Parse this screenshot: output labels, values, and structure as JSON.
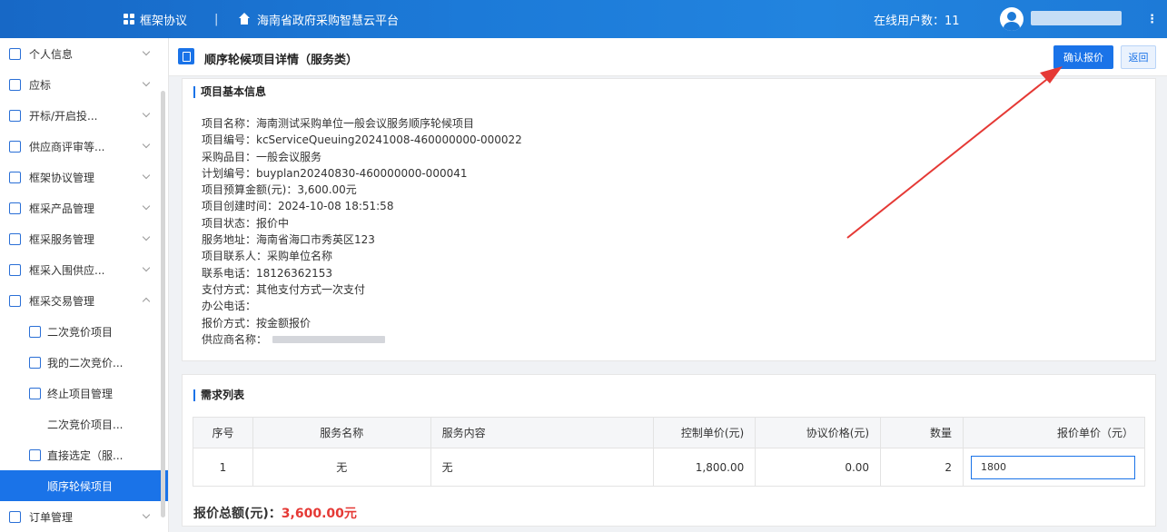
{
  "topbar": {
    "framework_label": "框架协议",
    "separator": "|",
    "platform_name": "海南省政府采购智慧云平台",
    "online_users": "在线用户数：11",
    "more_label": "⋮"
  },
  "sidebar": {
    "items": [
      {
        "label": "个人信息"
      },
      {
        "label": "应标"
      },
      {
        "label": "开标/开启投..."
      },
      {
        "label": "供应商评审等..."
      },
      {
        "label": "框架协议管理"
      },
      {
        "label": "框采产品管理"
      },
      {
        "label": "框采服务管理"
      },
      {
        "label": "框采入围供应..."
      },
      {
        "label": "框采交易管理"
      }
    ],
    "sub_items": [
      {
        "label": "二次竞价项目"
      },
      {
        "label": "我的二次竞价..."
      },
      {
        "label": "终止项目管理"
      },
      {
        "label": "二次竞价项目..."
      },
      {
        "label": "直接选定（服..."
      },
      {
        "label": "顺序轮候项目"
      }
    ],
    "last_item": {
      "label": "订单管理"
    }
  },
  "page": {
    "title": "顺序轮候项目详情（服务类）",
    "confirm_button": "确认报价",
    "back_button": "返回"
  },
  "basic_info": {
    "section_title": "项目基本信息",
    "rows": [
      "项目名称：海南测试采购单位一般会议服务顺序轮候项目",
      "项目编号：kcServiceQueuing20241008-460000000-000022",
      "采购品目：一般会议服务",
      "计划编号：buyplan20240830-460000000-000041",
      "项目预算金额(元)：3,600.00元",
      "项目创建时间：2024-10-08 18:51:58",
      "项目状态：报价中",
      "服务地址：海南省海口市秀英区123",
      "项目联系人：采购单位名称",
      "联系电话：18126362153",
      "支付方式：其他支付方式一次支付",
      "办公电话：",
      "报价方式：按金额报价"
    ],
    "supplier_label": "供应商名称："
  },
  "requirements": {
    "section_title": "需求列表",
    "headers": [
      "序号",
      "服务名称",
      "服务内容",
      "控制单价(元)",
      "协议价格(元)",
      "数量",
      "报价单价（元）"
    ],
    "row": {
      "index": "1",
      "service_name": "无",
      "service_content": "无",
      "control_price": "1,800.00",
      "agreement_price": "0.00",
      "quantity": "2",
      "quote_price": "1800"
    },
    "total_label": "报价总额(元)：",
    "total_value": "3,600.00元"
  },
  "colors": {
    "primary": "#1a73e8",
    "topbar": "#1d7ad7",
    "total_amount": "#e53935",
    "annotation_arrow": "#e53935"
  }
}
